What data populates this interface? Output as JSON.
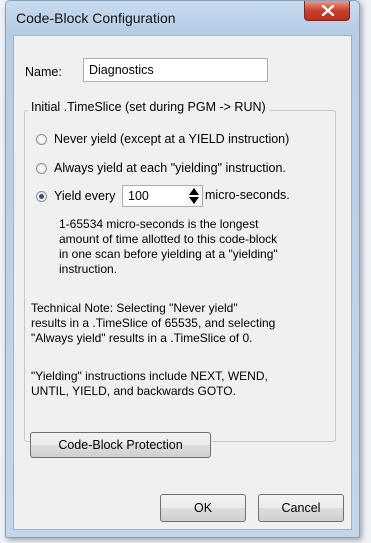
{
  "window": {
    "title": "Code-Block Configuration"
  },
  "name_field": {
    "label": "Name:",
    "value": "Diagnostics"
  },
  "timeslice_group": {
    "legend": "Initial .TimeSlice (set during PGM -> RUN)",
    "options": [
      {
        "label": "Never yield (except at a YIELD instruction)",
        "checked": false
      },
      {
        "label": "Always yield at each \"yielding\" instruction.",
        "checked": false
      },
      {
        "label": "Yield every",
        "checked": true
      }
    ],
    "yield_value": "100",
    "yield_unit": "micro-seconds.",
    "description": "1-65534 micro-seconds is the longest\namount of time allotted to this code-block\nin one scan before yielding at a \"yielding\"\ninstruction.",
    "technical_note": "Technical Note: Selecting \"Never yield\"\nresults in a .TimeSlice of 65535, and selecting\n\"Always yield\" results in a .TimeSlice of 0.",
    "yielding_note": "\"Yielding\" instructions include NEXT, WEND,\nUNTIL, YIELD, and backwards GOTO."
  },
  "buttons": {
    "protection": "Code-Block Protection",
    "ok": "OK",
    "cancel": "Cancel"
  },
  "icons": {
    "close": "close-icon",
    "spin_up": "arrow-up-icon",
    "spin_down": "arrow-down-icon"
  }
}
